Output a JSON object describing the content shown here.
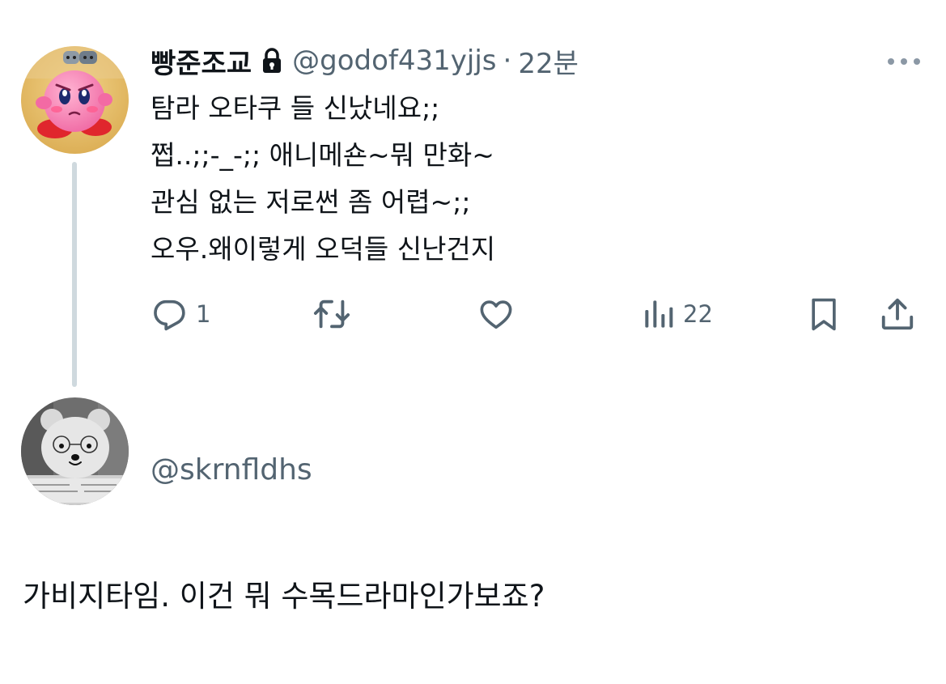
{
  "tweet": {
    "display_name": "빵준조교",
    "handle": "@godof431yjjs",
    "separator": "·",
    "time": "22분",
    "lines": [
      "탐라 오타쿠 들 신났네요;;",
      "쩝..;;-_-;; 애니메숀~뭐 만화~",
      "관심 없는 저로썬 좀 어렵~;;",
      "오우.왜이렇게 오덕들 신난건지"
    ],
    "actions": {
      "reply_count": "1",
      "views_count": "22"
    },
    "icons": {
      "lock": "lock-icon",
      "more": "more-horizontal-icon",
      "reply": "reply-icon",
      "retweet": "retweet-icon",
      "like": "heart-icon",
      "views": "views-icon",
      "bookmark": "bookmark-icon",
      "share": "share-icon"
    }
  },
  "reply": {
    "handle": "@skrnfldhs",
    "text": "가비지타임. 이건 뭐 수목드라마인가보죠?"
  },
  "colors": {
    "text": "#0f1419",
    "secondary": "#536471",
    "thread_line": "#cfd9de"
  }
}
